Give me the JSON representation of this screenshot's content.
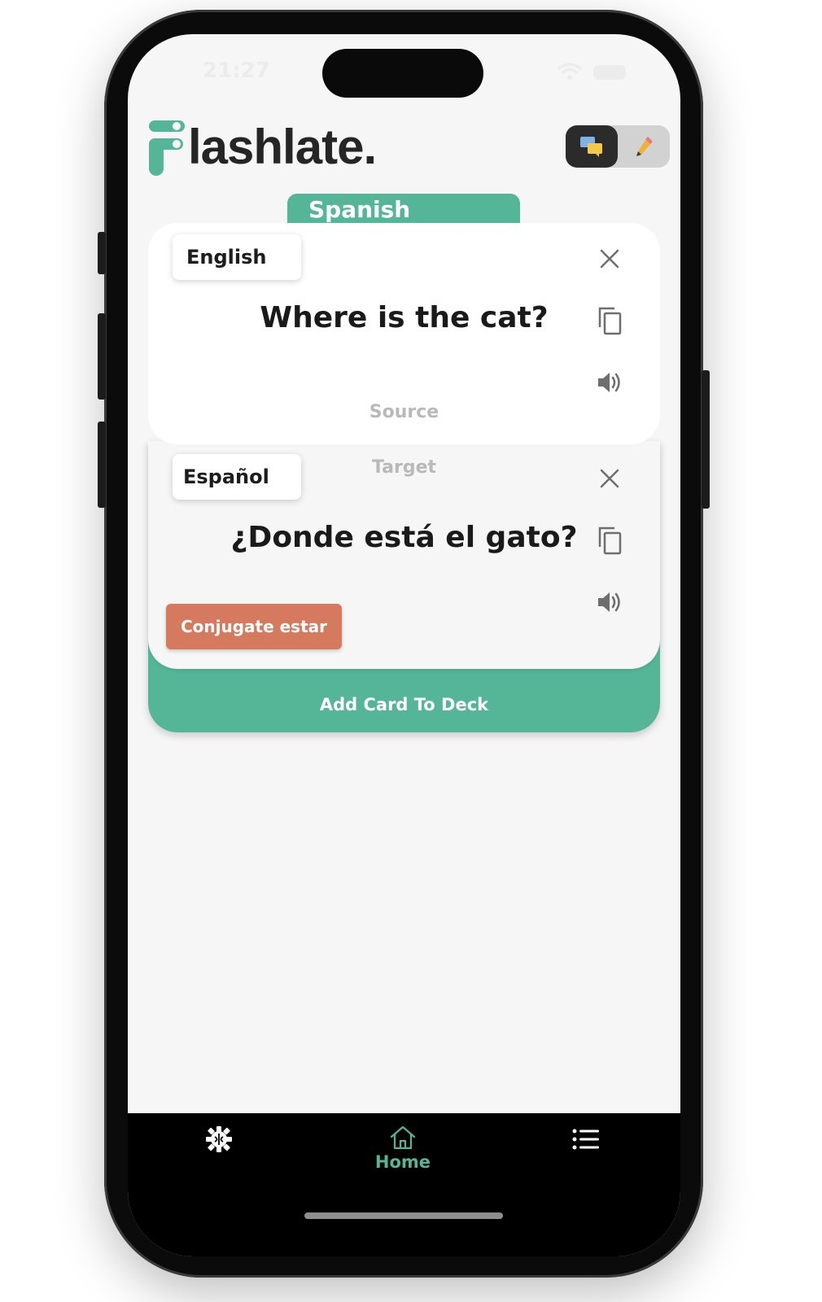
{
  "status_bar": {
    "time": "21:27"
  },
  "app": {
    "logo_text": "lashlate."
  },
  "mode_toggle": {
    "left_icon": "chat-bubbles-icon",
    "right_icon": "pencil-icon"
  },
  "language_tab": {
    "label": "Spanish"
  },
  "source_card": {
    "language": "English",
    "phrase": "Where is the cat?",
    "hint": "Source"
  },
  "target_card": {
    "language": "Español",
    "phrase": "¿Donde está el gato?",
    "hint": "Target",
    "conjugate_label": "Conjugate estar"
  },
  "add_card": {
    "label": "Add Card To Deck"
  },
  "tab_bar": {
    "items": [
      {
        "icon": "brain-gear-icon",
        "label": ""
      },
      {
        "icon": "home-icon",
        "label": "Home",
        "active": true
      },
      {
        "icon": "list-icon",
        "label": ""
      }
    ]
  },
  "colors": {
    "accent": "#55b697",
    "conjugate": "#d67a5f",
    "text": "#1a1a1a",
    "background": "#f6f6f6"
  }
}
